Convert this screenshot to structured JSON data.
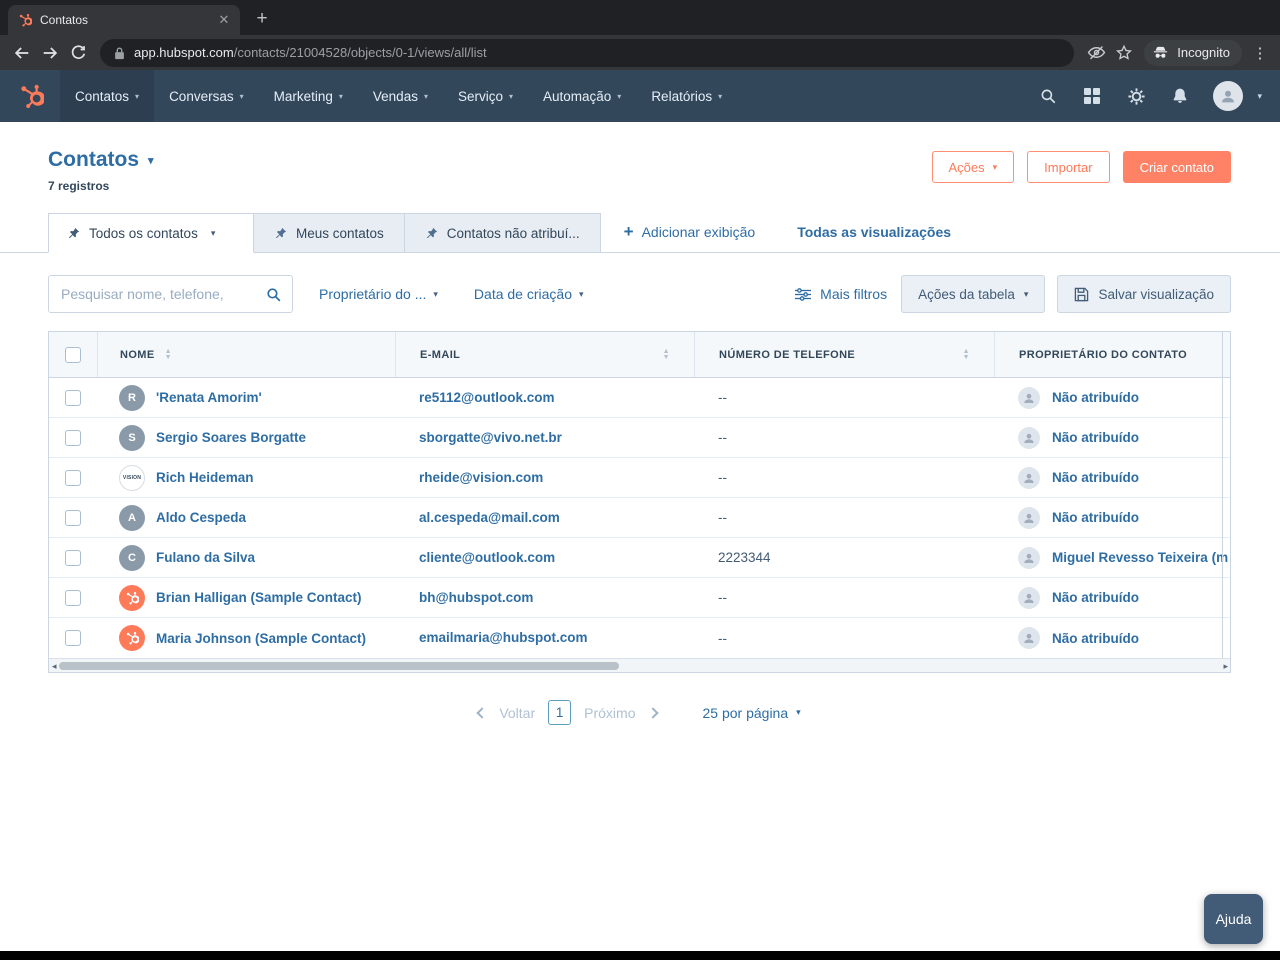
{
  "colors": {
    "accent_orange": "#ff7a59",
    "solid_button_orange": "#ff8266",
    "link_blue": "#2e6da4",
    "navy": "#33475b",
    "border_gray": "#cbd6e2",
    "table_header_bg": "#f5f8fa",
    "help_button_bg": "#425b76"
  },
  "browser": {
    "tab": {
      "title": "Contatos"
    },
    "address": {
      "host": "app.hubspot.com",
      "path": "/contacts/21004528/objects/0-1/views/all/list"
    },
    "incognito_label": "Incognito"
  },
  "nav": {
    "items": [
      {
        "label": "Contatos",
        "active": true
      },
      {
        "label": "Conversas",
        "active": false
      },
      {
        "label": "Marketing",
        "active": false
      },
      {
        "label": "Vendas",
        "active": false
      },
      {
        "label": "Serviço",
        "active": false
      },
      {
        "label": "Automação",
        "active": false
      },
      {
        "label": "Relatórios",
        "active": false
      }
    ]
  },
  "header": {
    "title": "Contatos",
    "records": "7 registros",
    "actions_label": "Ações",
    "import_label": "Importar",
    "create_label": "Criar contato"
  },
  "views": {
    "tabs": [
      {
        "label": "Todos os contatos",
        "active": true
      },
      {
        "label": "Meus contatos",
        "active": false
      },
      {
        "label": "Contatos não atribuí...",
        "active": false
      }
    ],
    "add_view": "Adicionar exibição",
    "all_views": "Todas as visualizações"
  },
  "filters": {
    "search_placeholder": "Pesquisar nome, telefone,",
    "owner_filter": "Proprietário do ...",
    "created_filter": "Data de criação",
    "more_filters": "Mais filtros",
    "table_actions": "Ações da tabela",
    "save_view": "Salvar visualização"
  },
  "table": {
    "columns": [
      {
        "label": "NOME",
        "sortable": true
      },
      {
        "label": "E-MAIL",
        "sortable": true
      },
      {
        "label": "NÚMERO DE TELEFONE",
        "sortable": true
      },
      {
        "label": "PROPRIETÁRIO DO CONTATO",
        "sortable": false
      }
    ],
    "rows": [
      {
        "avatar_type": "letter",
        "avatar": "R",
        "name": "'Renata Amorim'",
        "email": "re5112@outlook.com",
        "phone": "--",
        "owner": "Não atribuído"
      },
      {
        "avatar_type": "letter",
        "avatar": "S",
        "name": "Sergio Soares Borgatte",
        "email": "sborgatte@vivo.net.br",
        "phone": "--",
        "owner": "Não atribuído"
      },
      {
        "avatar_type": "logo",
        "avatar": "VISION",
        "name": "Rich Heideman",
        "email": "rheide@vision.com",
        "phone": "--",
        "owner": "Não atribuído"
      },
      {
        "avatar_type": "letter",
        "avatar": "A",
        "name": "Aldo Cespeda",
        "email": "al.cespeda@mail.com",
        "phone": "--",
        "owner": "Não atribuído"
      },
      {
        "avatar_type": "letter",
        "avatar": "C",
        "name": "Fulano da Silva",
        "email": "cliente@outlook.com",
        "phone": "2223344",
        "owner": "Miguel Revesso Teixeira (m"
      },
      {
        "avatar_type": "hubspot",
        "avatar": "",
        "name": "Brian Halligan (Sample Contact)",
        "email": "bh@hubspot.com",
        "phone": "--",
        "owner": "Não atribuído"
      },
      {
        "avatar_type": "hubspot",
        "avatar": "",
        "name": "Maria Johnson (Sample Contact)",
        "email": "emailmaria@hubspot.com",
        "phone": "--",
        "owner": "Não atribuído"
      }
    ]
  },
  "pagination": {
    "prev": "Voltar",
    "current_page": "1",
    "next": "Próximo",
    "per_page": "25 por página"
  },
  "help_label": "Ajuda"
}
